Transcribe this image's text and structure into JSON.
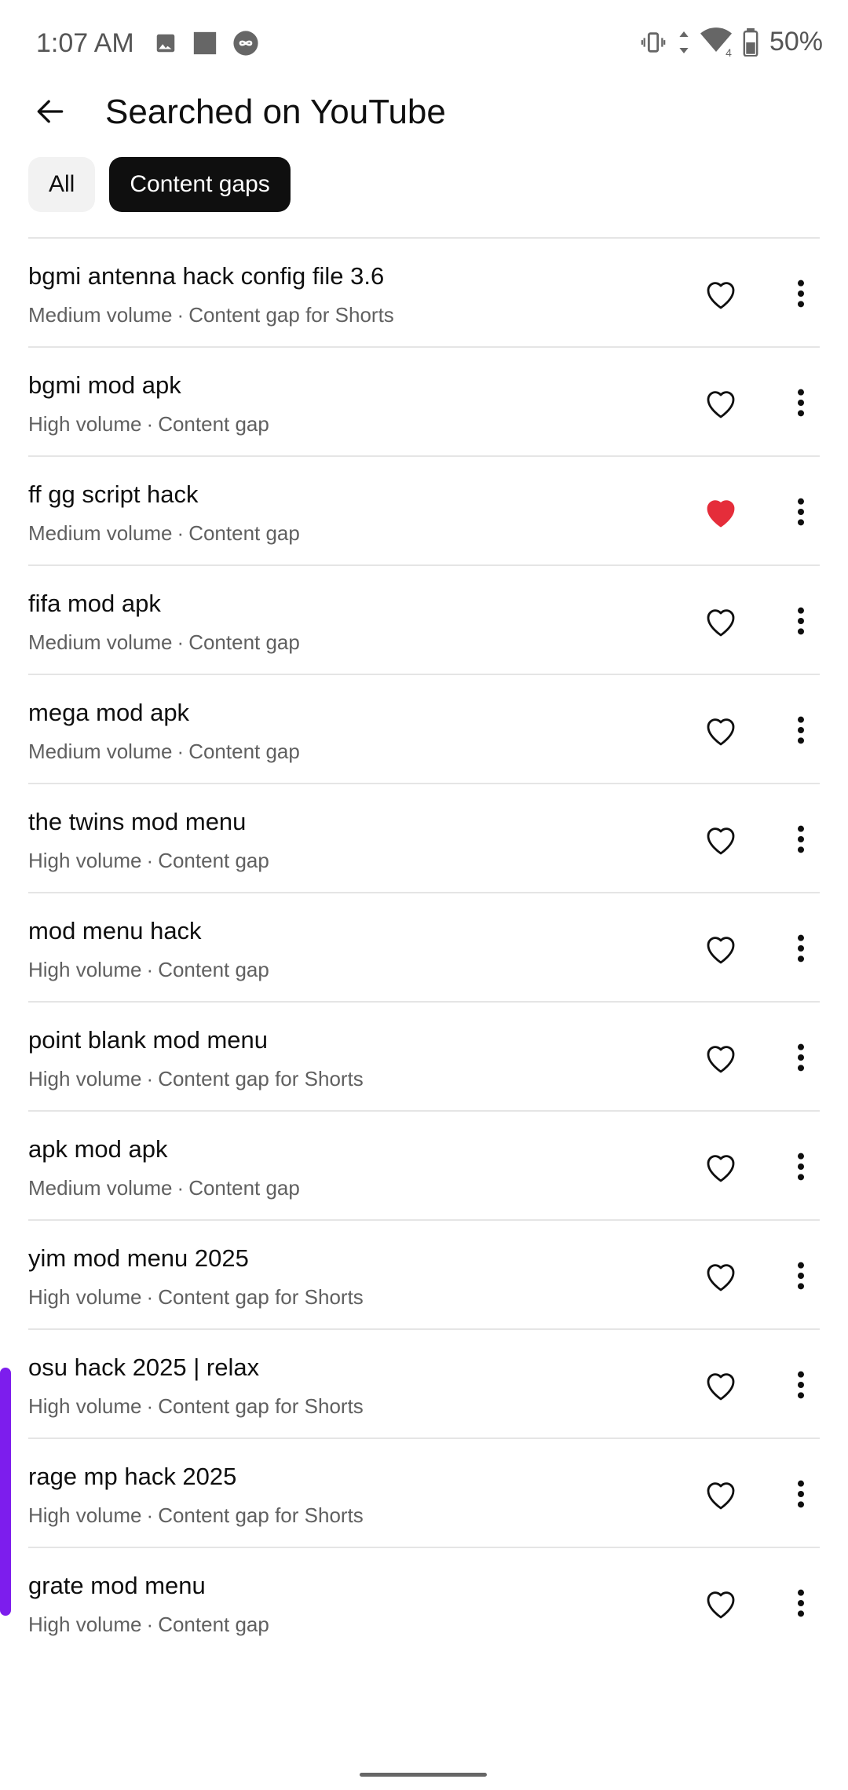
{
  "status_bar": {
    "time": "1:07 AM",
    "battery": "50%",
    "network_badge": "4"
  },
  "header": {
    "title": "Searched on YouTube",
    "back_icon": "arrow-left-icon"
  },
  "filters": {
    "all": "All",
    "active": "Content gaps"
  },
  "colors": {
    "liked_heart": "#e52d3a",
    "active_chip": "#0f0f0f",
    "scroll_indicator": "#7d1ded"
  },
  "rows": [
    {
      "title": "bgmi antenna hack config file 3.6",
      "volume": "Medium volume",
      "gap": "Content gap for Shorts",
      "liked": false
    },
    {
      "title": "bgmi mod apk",
      "volume": "High volume",
      "gap": "Content gap",
      "liked": false
    },
    {
      "title": "ff gg script hack",
      "volume": "Medium volume",
      "gap": "Content gap",
      "liked": true
    },
    {
      "title": "fifa mod apk",
      "volume": "Medium volume",
      "gap": "Content gap",
      "liked": false
    },
    {
      "title": "mega mod apk",
      "volume": "Medium volume",
      "gap": "Content gap",
      "liked": false
    },
    {
      "title": "the twins mod menu",
      "volume": "High volume",
      "gap": "Content gap",
      "liked": false
    },
    {
      "title": "mod menu hack",
      "volume": "High volume",
      "gap": "Content gap",
      "liked": false
    },
    {
      "title": "point blank mod menu",
      "volume": "High volume",
      "gap": "Content gap for Shorts",
      "liked": false
    },
    {
      "title": "apk mod apk",
      "volume": "Medium volume",
      "gap": "Content gap",
      "liked": false
    },
    {
      "title": "yim mod menu 2025",
      "volume": "High volume",
      "gap": "Content gap for Shorts",
      "liked": false
    },
    {
      "title": "osu hack 2025 | relax",
      "volume": "High volume",
      "gap": "Content gap for Shorts",
      "liked": false
    },
    {
      "title": "rage mp hack 2025",
      "volume": "High volume",
      "gap": "Content gap for Shorts",
      "liked": false
    },
    {
      "title": "grate mod menu",
      "volume": "High volume",
      "gap": "Content gap",
      "liked": false
    }
  ]
}
